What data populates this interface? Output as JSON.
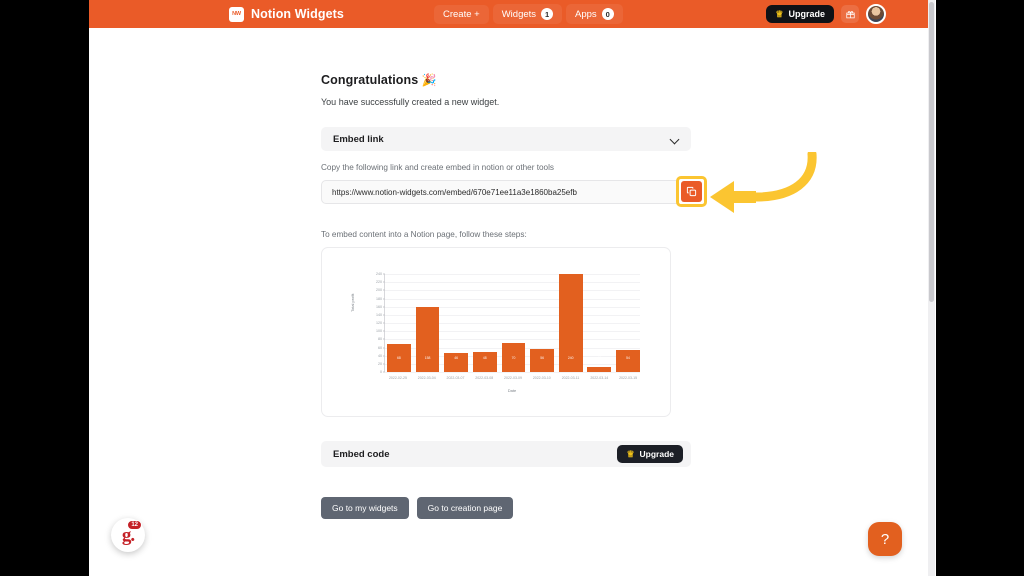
{
  "topnav": {
    "brand_mark": "NW",
    "brand_name": "Notion Widgets",
    "items": [
      {
        "label": "Create +",
        "count": null
      },
      {
        "label": "Widgets",
        "count": "1"
      },
      {
        "label": "Apps",
        "count": "0"
      }
    ],
    "upgrade_label": "Upgrade",
    "crown_icon": "crown-icon",
    "gift_icon": "🎁",
    "avatar": "user-avatar"
  },
  "main": {
    "heading": "Congratulations",
    "heading_emoji": "🎉",
    "subtitle": "You have successfully created a new widget.",
    "embed_link_section": {
      "title": "Embed link",
      "helper": "Copy the following link and create embed in notion or other tools",
      "url": "https://www.notion-widgets.com/embed/670e71ee11a3e1860ba25efb",
      "copy_icon": "copy-icon"
    },
    "steps_label": "To embed content into a Notion page, follow these steps:",
    "embed_code_section": {
      "title": "Embed code",
      "upgrade_label": "Upgrade"
    },
    "buttons": [
      {
        "label": "Go to my widgets"
      },
      {
        "label": "Go to creation page"
      }
    ]
  },
  "floating": {
    "grammarly_letter": "g.",
    "grammarly_count": "12",
    "help_glyph": "?"
  },
  "colors": {
    "brand_orange": "#ea5b28",
    "bar_orange": "#e2601f",
    "highlight_yellow": "#fbc531",
    "dark_button": "#101216",
    "gray_button": "#5f6672"
  },
  "chart_data": {
    "type": "bar",
    "title": "",
    "xlabel": "Date",
    "ylabel": "Total profit",
    "categories": [
      "2022-02-25",
      "2022-03-04",
      "2022-03-07",
      "2022-03-08",
      "2022-03-09",
      "2022-03-10",
      "2022-03-11",
      "2022-03-14",
      "2022-03-15"
    ],
    "values": [
      68,
      158,
      46,
      48,
      70,
      56,
      240,
      12,
      54
    ],
    "yticks": [
      0,
      20,
      40,
      60,
      80,
      100,
      120,
      140,
      160,
      180,
      200,
      220,
      240
    ],
    "ylim": [
      0,
      240
    ],
    "grid": true,
    "legend": false,
    "bar_color": "#e2601f",
    "data_labels": true
  }
}
